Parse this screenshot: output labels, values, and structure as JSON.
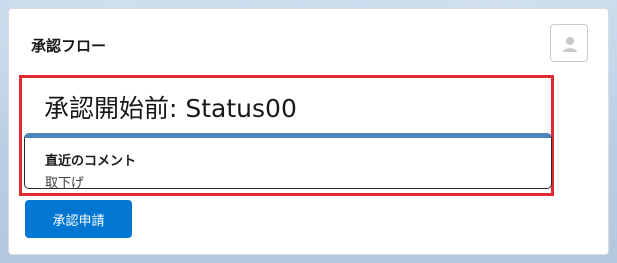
{
  "card": {
    "title": "承認フロー"
  },
  "status": {
    "text": "承認開始前: Status00"
  },
  "comment": {
    "header": "直近のコメント",
    "text": "取下げ"
  },
  "actions": {
    "submit_label": "承認申請"
  },
  "icons": {
    "avatar": "user-avatar-icon"
  },
  "colors": {
    "highlight_border": "#e12a2f",
    "comment_accent": "#4a86b8",
    "primary_button": "#0176d3"
  }
}
